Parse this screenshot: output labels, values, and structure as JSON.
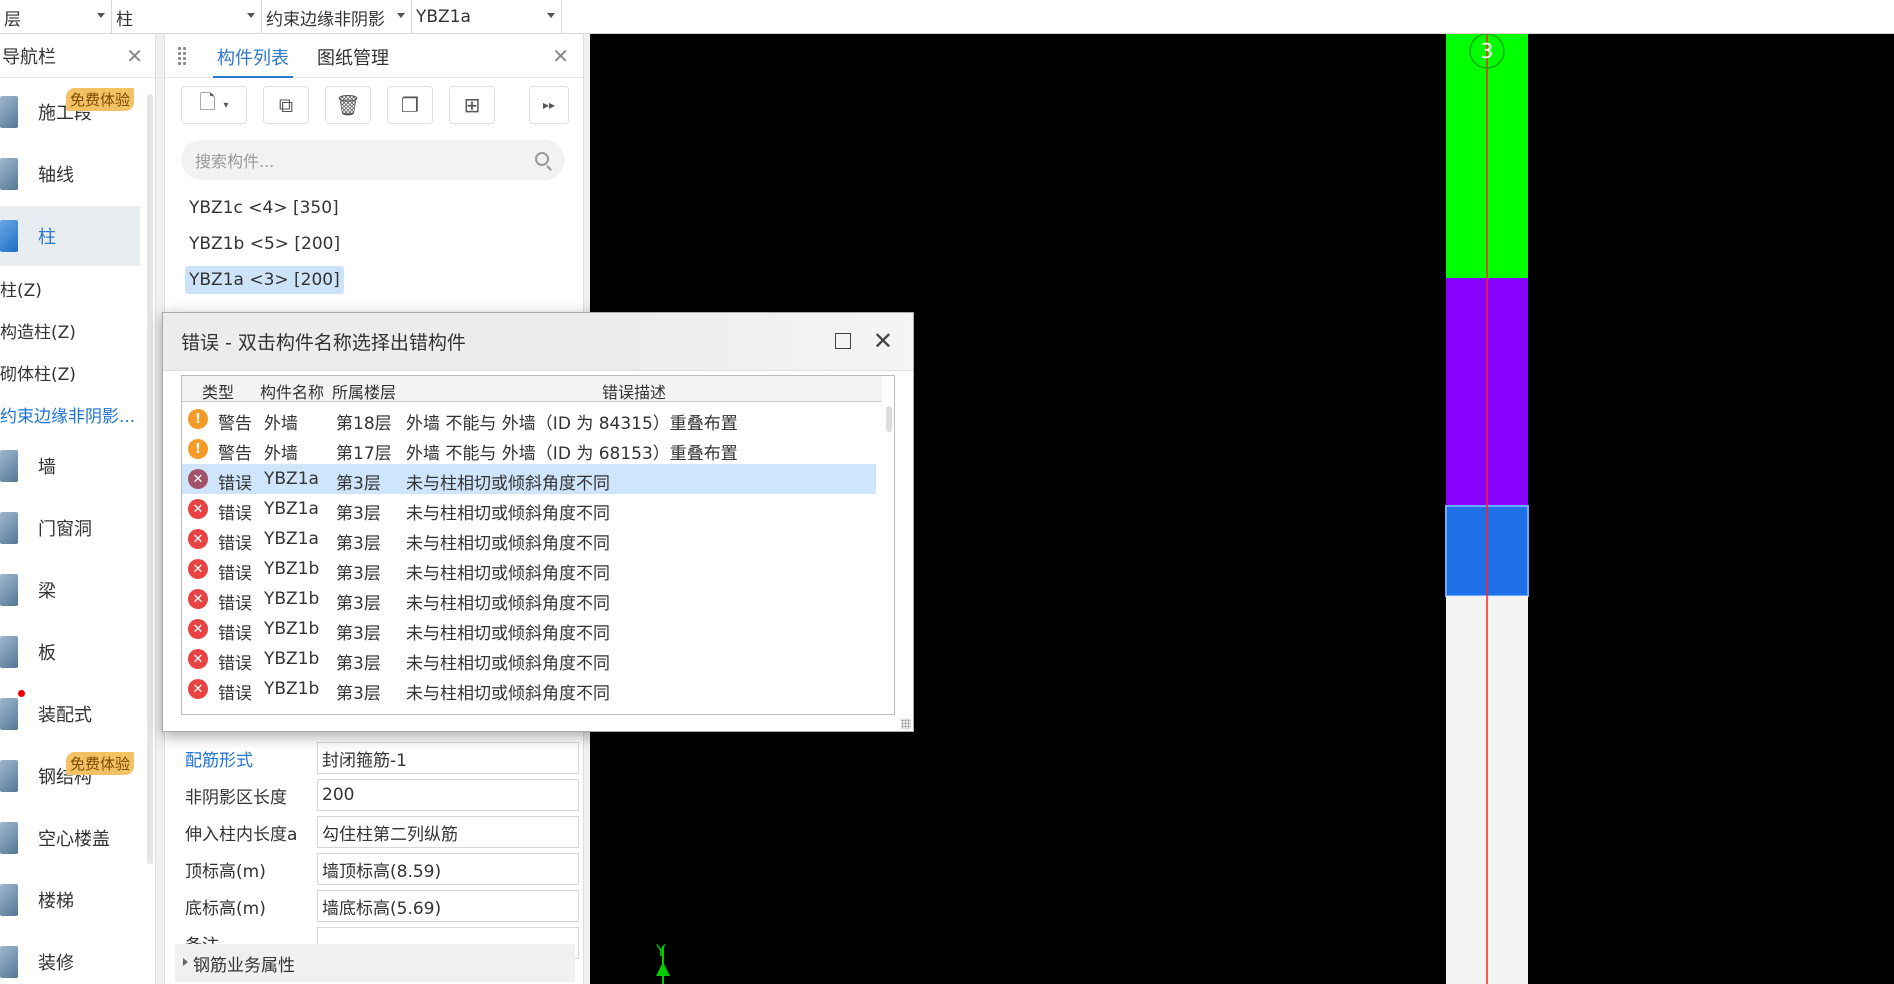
{
  "topbar": {
    "combo1": "层",
    "combo2": "柱",
    "combo3": "约束边缘非阴影",
    "combo4": "YBZ1a"
  },
  "nav": {
    "title": "导航栏",
    "items": [
      {
        "label": "施工段",
        "badge": "免费体验"
      },
      {
        "label": "轴线"
      },
      {
        "label": "柱"
      },
      {
        "label": "墙"
      },
      {
        "label": "门窗洞"
      },
      {
        "label": "梁"
      },
      {
        "label": "板"
      },
      {
        "label": "装配式"
      },
      {
        "label": "钢结构",
        "badge": "免费体验"
      },
      {
        "label": "空心楼盖"
      },
      {
        "label": "楼梯"
      },
      {
        "label": "装修"
      }
    ],
    "subitems": [
      "柱(Z)",
      "构造柱(Z)",
      "砌体柱(Z)",
      "约束边缘非阴影..."
    ]
  },
  "component_panel": {
    "tab_list": "构件列表",
    "tab_drawings": "图纸管理",
    "search_placeholder": "搜索构件...",
    "items": [
      "YBZ1c <4> [350]",
      "YBZ1b <5> [200]",
      "YBZ1a <3> [200]"
    ],
    "properties": [
      {
        "key": "配筋形式",
        "value": "封闭箍筋-1"
      },
      {
        "key": "非阴影区长度",
        "value": "200"
      },
      {
        "key": "伸入柱内长度a",
        "value": "勾住柱第二列纵筋"
      },
      {
        "key": "顶标高(m)",
        "value": "墙顶标高(8.59)"
      },
      {
        "key": "底标高(m)",
        "value": "墙底标高(5.69)"
      },
      {
        "key": "备注",
        "value": ""
      }
    ],
    "section": "钢筋业务属性"
  },
  "dialog": {
    "title": "错误 - 双击构件名称选择出错构件",
    "columns": [
      "类型",
      "构件名称",
      "所属楼层",
      "错误描述"
    ],
    "rows": [
      {
        "kind": "warn",
        "type": "警告",
        "name": "外墙",
        "floor": "第18层",
        "desc": "外墙 不能与 外墙（ID 为 84315）重叠布置"
      },
      {
        "kind": "warn",
        "type": "警告",
        "name": "外墙",
        "floor": "第17层",
        "desc": "外墙 不能与 外墙（ID 为 68153）重叠布置"
      },
      {
        "kind": "err-sel",
        "type": "错误",
        "name": "YBZ1a",
        "floor": "第3层",
        "desc": "未与柱相切或倾斜角度不同"
      },
      {
        "kind": "err",
        "type": "错误",
        "name": "YBZ1a",
        "floor": "第3层",
        "desc": "未与柱相切或倾斜角度不同"
      },
      {
        "kind": "err",
        "type": "错误",
        "name": "YBZ1a",
        "floor": "第3层",
        "desc": "未与柱相切或倾斜角度不同"
      },
      {
        "kind": "err",
        "type": "错误",
        "name": "YBZ1b",
        "floor": "第3层",
        "desc": "未与柱相切或倾斜角度不同"
      },
      {
        "kind": "err",
        "type": "错误",
        "name": "YBZ1b",
        "floor": "第3层",
        "desc": "未与柱相切或倾斜角度不同"
      },
      {
        "kind": "err",
        "type": "错误",
        "name": "YBZ1b",
        "floor": "第3层",
        "desc": "未与柱相切或倾斜角度不同"
      },
      {
        "kind": "err",
        "type": "错误",
        "name": "YBZ1b",
        "floor": "第3层",
        "desc": "未与柱相切或倾斜角度不同"
      },
      {
        "kind": "err",
        "type": "错误",
        "name": "YBZ1b",
        "floor": "第3层",
        "desc": "未与柱相切或倾斜角度不同"
      }
    ]
  },
  "canvas": {
    "axis_label": "3",
    "y_label": "Y",
    "colors": {
      "green": "#00ff00",
      "purple": "#8800ff",
      "blue": "#1f6fe8",
      "white": "#f4f4f4",
      "axis": "#ff2020"
    }
  }
}
